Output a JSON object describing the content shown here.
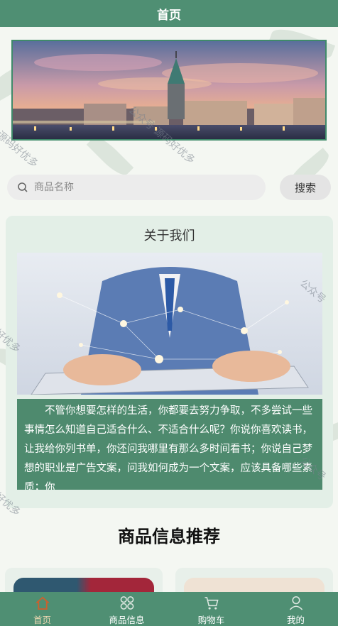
{
  "header": {
    "title": "首页"
  },
  "search": {
    "placeholder": "商品名称",
    "button_label": "搜索"
  },
  "about": {
    "title": "关于我们",
    "text": "不管你想要怎样的生活，你都要去努力争取，不多尝试一些事情怎么知道自己适合什么、不适合什么呢？你说你喜欢读书，让我给你列书单，你还问我哪里有那么多时间看书；你说自己梦想的职业是广告文案，问我如何成为一个文案，应该具备哪些素质；你"
  },
  "recommend": {
    "title": "商品信息推荐"
  },
  "tabbar": {
    "items": [
      {
        "label": "首页",
        "icon": "home-icon",
        "active": true
      },
      {
        "label": "商品信息",
        "icon": "grid-icon",
        "active": false
      },
      {
        "label": "购物车",
        "icon": "cart-icon",
        "active": false
      },
      {
        "label": "我的",
        "icon": "user-icon",
        "active": false
      }
    ]
  },
  "watermarks": [
    "公众号 源码好优多",
    "源码好优多",
    "公众号",
    "好优多"
  ],
  "colors": {
    "primary": "#4f8f73",
    "active_tab": "#e8d6b0",
    "panel": "#e3efe7"
  }
}
